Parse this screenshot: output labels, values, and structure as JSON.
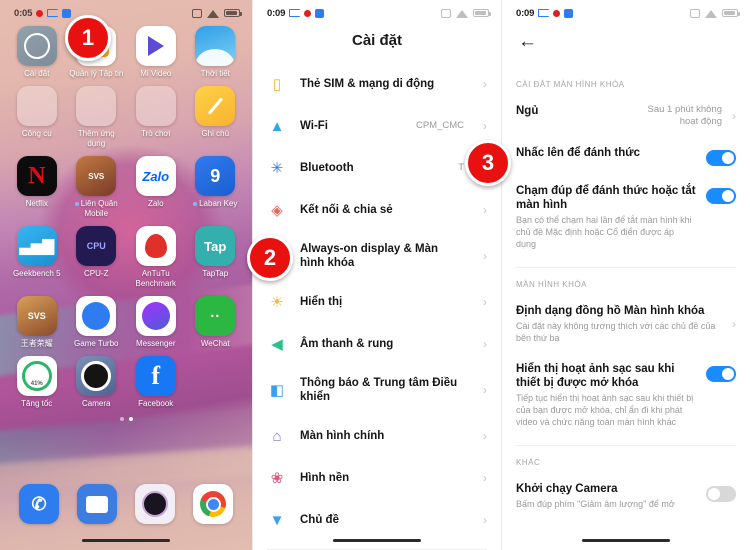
{
  "home": {
    "statusbar": {
      "time": "0:05",
      "icons": [
        "record-dot-icon",
        "cast-icon",
        "screen-recorder-icon",
        "alarm-icon",
        "wifi-icon",
        "battery-icon"
      ]
    },
    "apps": [
      {
        "label": "Cài đặt",
        "icon": "settings-icon",
        "badge": false
      },
      {
        "label": "Quản lý Tập tin",
        "icon": "file-manager-icon",
        "badge": false
      },
      {
        "label": "Mi Video",
        "icon": "mi-video-icon",
        "badge": false
      },
      {
        "label": "Thời tiết",
        "icon": "weather-icon",
        "badge": false
      },
      {
        "label": "Công cụ",
        "icon": "tools-folder-icon",
        "badge": false
      },
      {
        "label": "Thêm ứng dụng",
        "icon": "more-apps-folder-icon",
        "badge": false
      },
      {
        "label": "Trò chơi",
        "icon": "games-folder-icon",
        "badge": false
      },
      {
        "label": "Ghi chú",
        "icon": "notes-icon",
        "badge": false
      },
      {
        "label": "Netflix",
        "icon": "netflix-icon",
        "badge": false
      },
      {
        "label": "Liên Quân Mobile",
        "icon": "lien-quan-mobile-icon",
        "badge": true
      },
      {
        "label": "Zalo",
        "icon": "zalo-icon",
        "badge": false
      },
      {
        "label": "Laban Key",
        "icon": "laban-key-icon",
        "badge": true
      },
      {
        "label": "Geekbench 5",
        "icon": "geekbench-icon",
        "badge": false
      },
      {
        "label": "CPU-Z",
        "icon": "cpu-z-icon",
        "badge": false
      },
      {
        "label": "AnTuTu Benchmark",
        "icon": "antutu-icon",
        "badge": false
      },
      {
        "label": "TapTap",
        "icon": "taptap-icon",
        "badge": false
      },
      {
        "label": "王者荣耀",
        "icon": "wangzhe-rongyao-icon",
        "badge": false
      },
      {
        "label": "Game Turbo",
        "icon": "game-turbo-icon",
        "badge": false
      },
      {
        "label": "Messenger",
        "icon": "messenger-icon",
        "badge": false
      },
      {
        "label": "WeChat",
        "icon": "wechat-icon",
        "badge": false
      },
      {
        "label": "Tăng tốc",
        "icon": "boost-icon",
        "badge": false
      },
      {
        "label": "Camera",
        "icon": "camera-icon",
        "badge": false
      },
      {
        "label": "Facebook",
        "icon": "facebook-icon",
        "badge": false
      }
    ],
    "boost_percent": "41%",
    "netflix_glyph": "N",
    "zalo_glyph": "Zalo",
    "laban_glyph": "9",
    "taptap_glyph": "Tap",
    "cpuz_glyph": "CPU",
    "wechat_glyph": "··",
    "facebook_glyph": "f",
    "phone_glyph": "✆",
    "lqm_glyph": "SVS",
    "wzry_glyph": "SVS",
    "geek_glyph": "▃▅▇",
    "dock": [
      {
        "label": "phone",
        "icon": "phone-icon"
      },
      {
        "label": "messages",
        "icon": "messages-icon"
      },
      {
        "label": "camera",
        "icon": "camera-icon"
      },
      {
        "label": "chrome",
        "icon": "chrome-icon"
      }
    ]
  },
  "settings": {
    "statusbar": {
      "time": "0:09"
    },
    "title": "Cài đặt",
    "rows": [
      {
        "icon": "sim-card-icon",
        "label": "Thẻ SIM & mạng di động",
        "value": "",
        "chevron": "›"
      },
      {
        "icon": "wifi-icon",
        "label": "Wi-Fi",
        "value": "CPM_CMC",
        "chevron": "›"
      },
      {
        "icon": "bluetooth-icon",
        "label": "Bluetooth",
        "value": "T",
        "chevron": "›"
      },
      {
        "icon": "connection-sharing-icon",
        "label": "Kết nối & chia sẻ",
        "value": "",
        "chevron": "›"
      },
      {
        "icon": "always-on-display-icon",
        "label": "Always-on display & Màn hình khóa",
        "value": "",
        "chevron": "›"
      },
      {
        "icon": "brightness-icon",
        "label": "Hiển thị",
        "value": "",
        "chevron": "›"
      },
      {
        "icon": "sound-icon",
        "label": "Âm thanh & rung",
        "value": "",
        "chevron": "›"
      },
      {
        "icon": "notification-icon",
        "label": "Thông báo & Trung tâm Điều khiển",
        "value": "",
        "chevron": "›"
      },
      {
        "icon": "home-screen-icon",
        "label": "Màn hình chính",
        "value": "",
        "chevron": "›"
      },
      {
        "icon": "wallpaper-icon",
        "label": "Hình nền",
        "value": "",
        "chevron": "›"
      },
      {
        "icon": "theme-icon",
        "label": "Chủ đề",
        "value": "",
        "chevron": "›"
      }
    ]
  },
  "lockscreen": {
    "statusbar": {
      "time": "0:09"
    },
    "back_icon": "back-arrow-icon",
    "section1_header": "CÀI ĐẶT MÀN HÌNH KHÓA",
    "section2_header": "MÀN HÌNH KHÓA",
    "section3_header": "KHÁC",
    "items": [
      {
        "title": "Ngủ",
        "subtitle": "",
        "value": "Sau 1 phút không hoạt động",
        "control": "chevron",
        "chevron": "›"
      },
      {
        "title": "Nhấc lên để đánh thức",
        "subtitle": "",
        "value": "",
        "control": "toggle",
        "toggle_on": true
      },
      {
        "title": "Chạm đúp để đánh thức hoặc tắt màn hình",
        "subtitle": "Bạn có thể chạm hai lần để tắt màn hình khi chủ đề Mặc định hoặc Cổ điển được áp dụng",
        "value": "",
        "control": "toggle",
        "toggle_on": true
      },
      {
        "title": "Định dạng đồng hồ Màn hình khóa",
        "subtitle": "Cài đặt này không tương thích với các chủ đề của bên thứ ba",
        "value": "",
        "control": "chevron",
        "chevron": "›"
      },
      {
        "title": "Hiển thị hoạt ảnh sạc sau khi thiết bị được mở khóa",
        "subtitle": "Tiếp tục hiển thị hoạt ảnh sạc sau khi thiết bị của bạn được mở khóa, chỉ ẩn đi khi phát video và chức năng toàn màn hình khác",
        "value": "",
        "control": "toggle",
        "toggle_on": true
      },
      {
        "title": "Khởi chạy Camera",
        "subtitle": "Bấm đúp phím \"Giảm âm lượng\" để mở",
        "value": "",
        "control": "toggle",
        "toggle_on": false
      }
    ]
  },
  "callouts": [
    {
      "number": "1",
      "color": "#e8110f"
    },
    {
      "number": "2",
      "color": "#e8110f"
    },
    {
      "number": "3",
      "color": "#e8110f"
    }
  ]
}
